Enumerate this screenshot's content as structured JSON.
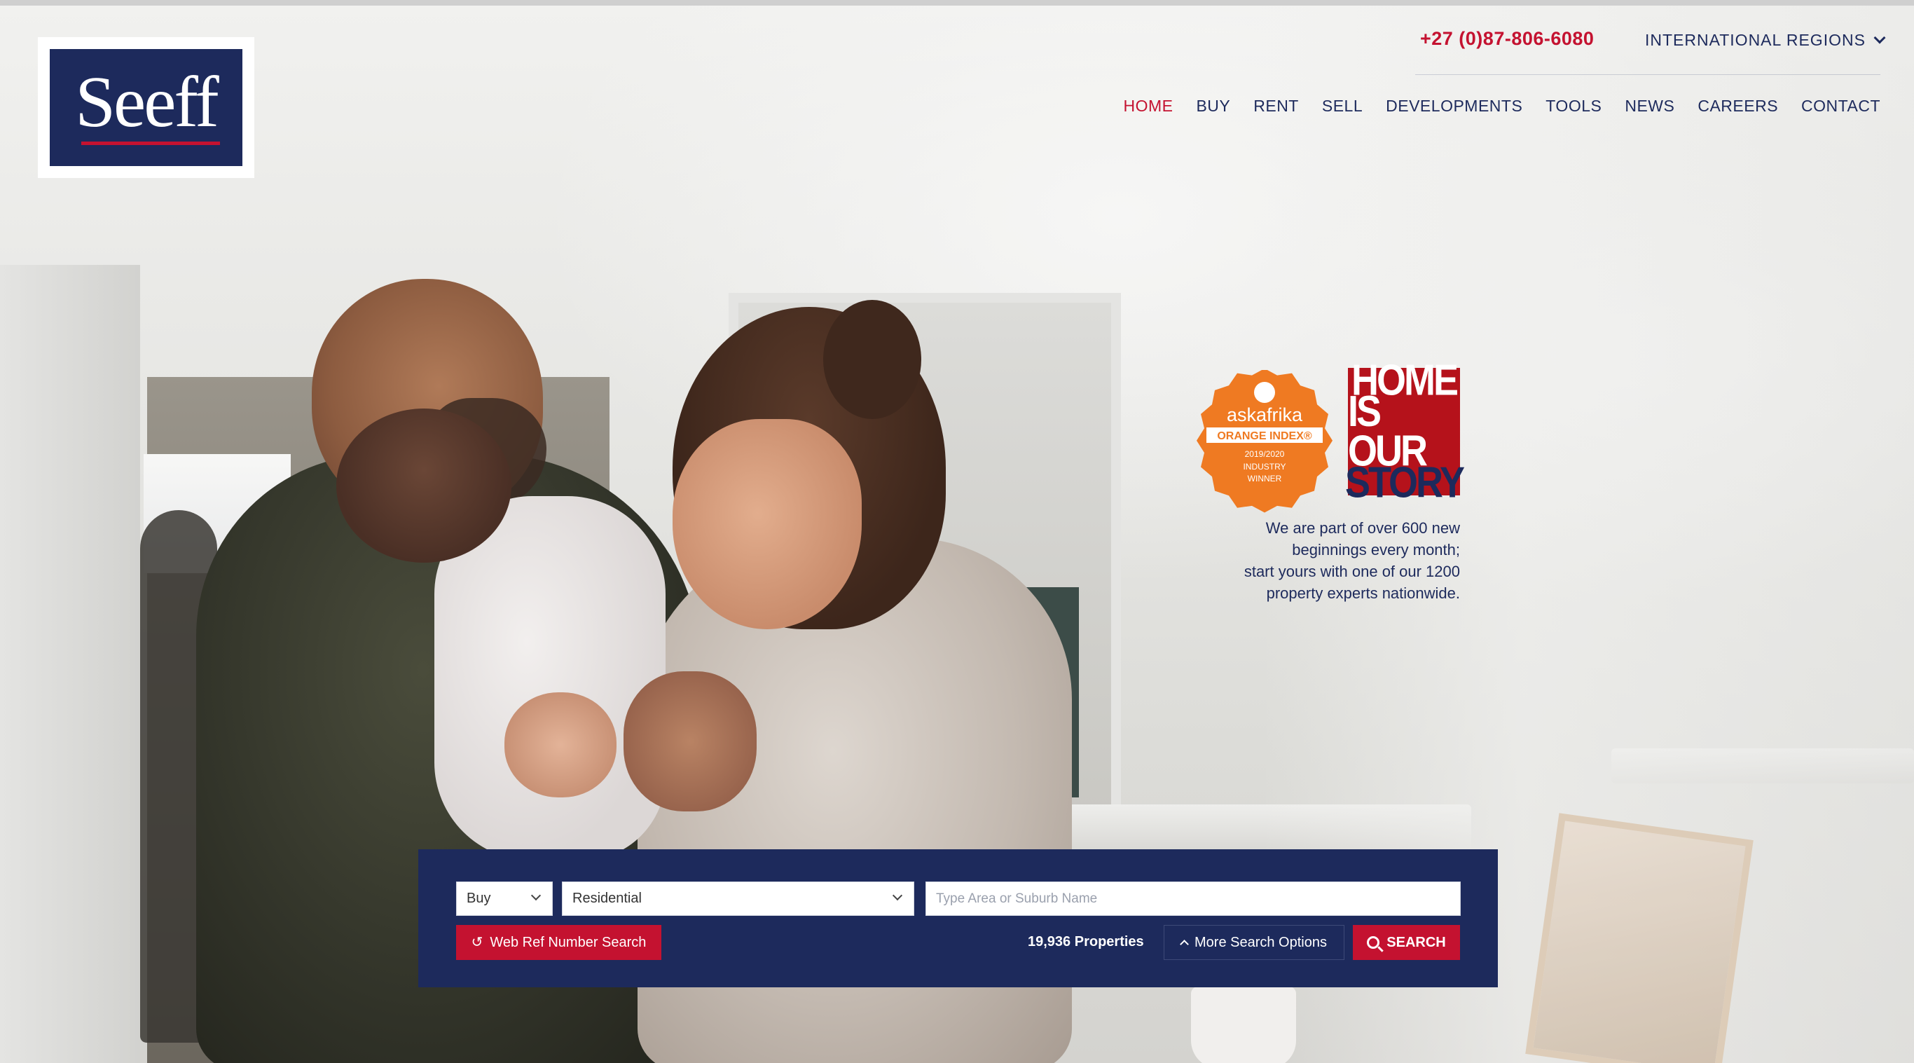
{
  "header": {
    "logo_text": "Seeff",
    "phone": "+27 (0)87-806-6080",
    "international_regions": "INTERNATIONAL REGIONS"
  },
  "nav": {
    "items": [
      {
        "label": "HOME",
        "active": true
      },
      {
        "label": "BUY",
        "active": false
      },
      {
        "label": "RENT",
        "active": false
      },
      {
        "label": "SELL",
        "active": false
      },
      {
        "label": "DEVELOPMENTS",
        "active": false
      },
      {
        "label": "TOOLS",
        "active": false
      },
      {
        "label": "NEWS",
        "active": false
      },
      {
        "label": "CAREERS",
        "active": false
      },
      {
        "label": "CONTACT",
        "active": false
      }
    ]
  },
  "badges": {
    "askafrika": {
      "brand": "askafrika",
      "index": "ORANGE INDEX®",
      "years": "2019/2020",
      "line1": "INDUSTRY",
      "line2": "WINNER"
    },
    "home_story": {
      "line1": "HOME",
      "line2": "IS OUR",
      "line3": "STORY"
    }
  },
  "tagline": {
    "line1": "We are part of over 600 new",
    "line2": "beginnings every month;",
    "line3": "start yours with one of our 1200",
    "line4": "property experts nationwide."
  },
  "search": {
    "listing_type": "Buy",
    "property_type": "Residential",
    "area_placeholder": "Type Area or Suburb Name",
    "web_ref_label": "Web Ref Number Search",
    "property_count": "19,936 Properties",
    "more_options_label": "More Search Options",
    "search_label": "SEARCH"
  },
  "colors": {
    "brand_navy": "#1d2a5c",
    "brand_red": "#c41230",
    "badge_orange": "#ef7a22"
  },
  "icons": [
    "chevron-down-icon",
    "refresh-icon",
    "chevron-up-icon",
    "search-icon"
  ]
}
